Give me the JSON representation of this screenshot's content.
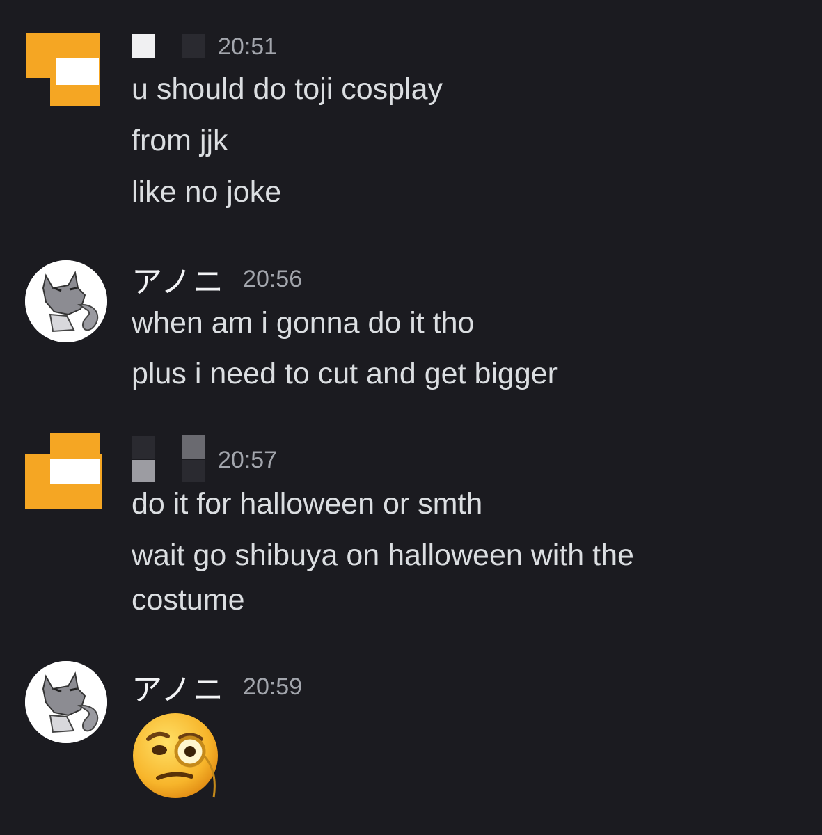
{
  "colors": {
    "background": "#1b1b20",
    "text": "#dbdee1",
    "timestamp": "#a3a6ad",
    "redacted_avatar_orange": "#f5a623"
  },
  "messages": [
    {
      "author": "",
      "author_redacted": true,
      "avatar": "redacted-orange-block",
      "time": "20:51",
      "lines": [
        "u should do toji cosplay",
        "from jjk",
        "like no joke"
      ]
    },
    {
      "author": "アノニ",
      "author_redacted": false,
      "avatar": "wolf-avatar-icon",
      "time": "20:56",
      "lines": [
        "when am i gonna do it tho",
        "plus i need to cut and get bigger"
      ]
    },
    {
      "author": "",
      "author_redacted": true,
      "avatar": "redacted-orange-block",
      "time": "20:57",
      "lines": [
        "do it for halloween or smth",
        "wait go shibuya on halloween with the",
        "costume"
      ]
    },
    {
      "author": "アノニ",
      "author_redacted": false,
      "avatar": "wolf-avatar-icon",
      "time": "20:59",
      "emoji": "face-with-monocle-icon"
    }
  ]
}
